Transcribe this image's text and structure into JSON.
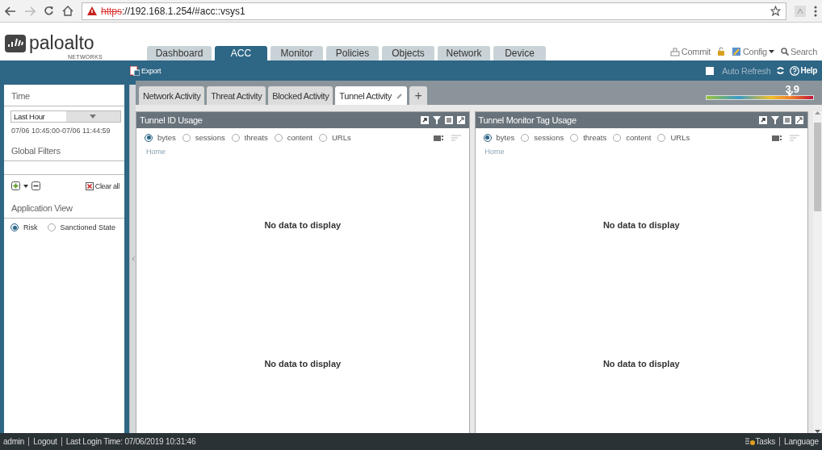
{
  "browser": {
    "url": {
      "scheme": "https",
      "rest": "://192.168.1.254/#acc::vsys1"
    }
  },
  "header": {
    "logo": {
      "name": "paloalto",
      "sub": "NETWORKS"
    },
    "tabs": [
      {
        "label": "Dashboard",
        "selected": false
      },
      {
        "label": "ACC",
        "selected": true
      },
      {
        "label": "Monitor",
        "selected": false
      },
      {
        "label": "Policies",
        "selected": false
      },
      {
        "label": "Objects",
        "selected": false
      },
      {
        "label": "Network",
        "selected": false
      },
      {
        "label": "Device",
        "selected": false
      }
    ],
    "actions": [
      "Commit",
      "Config",
      "Search"
    ]
  },
  "toolbar": {
    "export": "Export",
    "auto_refresh": {
      "label": "Auto Refresh",
      "checked": false
    },
    "help": "Help"
  },
  "risk_meter": {
    "reading": "3.9",
    "level": 0.78
  },
  "sidebar": {
    "time_title": "Time",
    "time_select": "Last Hour",
    "time_range": "07/06 10:45:00-07/06 11:44:59",
    "filters_title": "Global Filters",
    "clear_all": "Clear all",
    "view_title": "Application View",
    "view_options": [
      {
        "label": "Risk",
        "selected": true
      },
      {
        "label": "Sanctioned State",
        "selected": false
      }
    ]
  },
  "subtabs": [
    {
      "label": "Network Activity",
      "selected": false
    },
    {
      "label": "Threat Activity",
      "selected": false
    },
    {
      "label": "Blocked Activity",
      "selected": false
    },
    {
      "label": "Tunnel Activity",
      "selected": true
    }
  ],
  "add_tab": "+",
  "widgets": [
    {
      "title": "Tunnel ID Usage",
      "options": [
        {
          "label": "bytes",
          "selected": true
        },
        {
          "label": "sessions",
          "selected": false
        },
        {
          "label": "threats",
          "selected": false
        },
        {
          "label": "content",
          "selected": false
        },
        {
          "label": "URLs",
          "selected": false
        }
      ],
      "breadcrumb": "Home",
      "messages": [
        "No data to display",
        "No data to display"
      ]
    },
    {
      "title": "Tunnel Monitor Tag Usage",
      "options": [
        {
          "label": "bytes",
          "selected": true
        },
        {
          "label": "sessions",
          "selected": false
        },
        {
          "label": "threats",
          "selected": false
        },
        {
          "label": "content",
          "selected": false
        },
        {
          "label": "URLs",
          "selected": false
        }
      ],
      "breadcrumb": "Home",
      "messages": [
        "No data to display",
        "No data to display"
      ]
    }
  ],
  "status_bar": {
    "left": [
      "admin",
      "Logout",
      "Last Login Time: 07/06/2019 10:31:46"
    ],
    "right": [
      "Tasks",
      "Language"
    ]
  }
}
